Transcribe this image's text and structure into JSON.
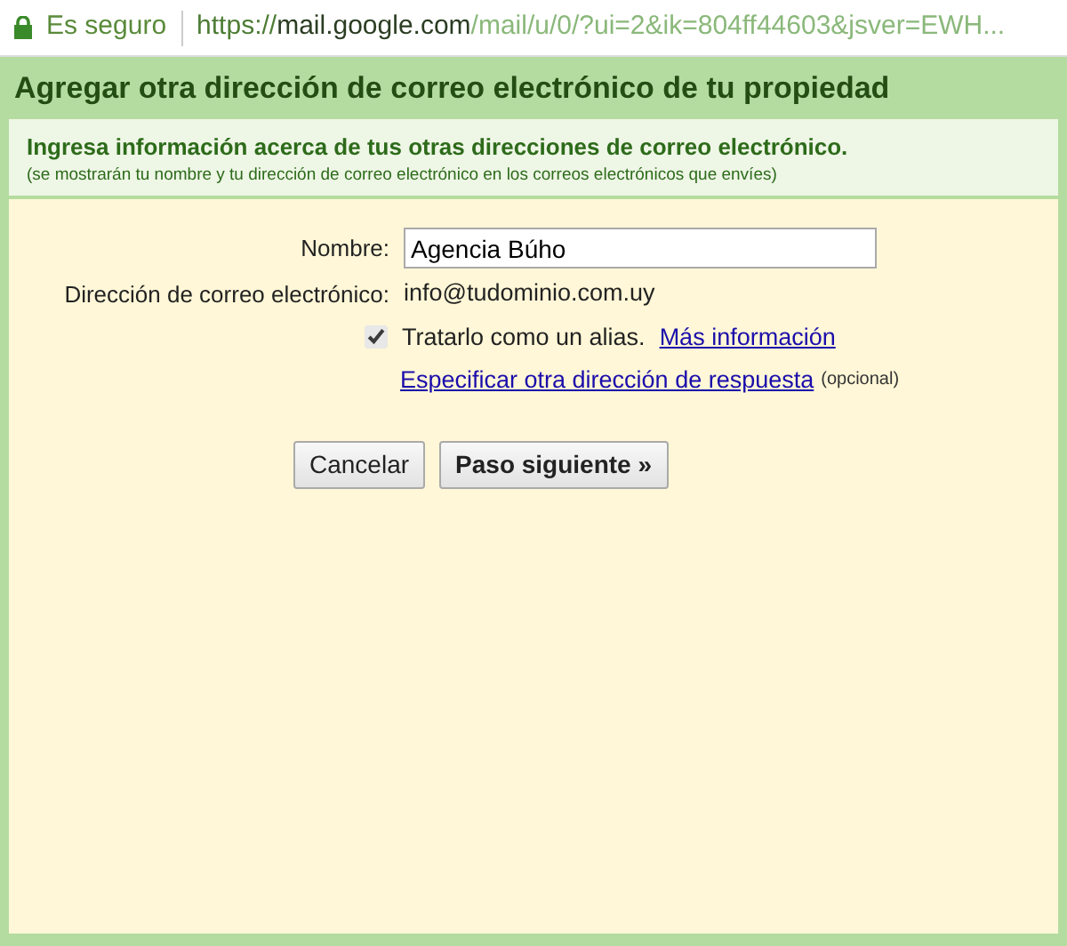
{
  "address_bar": {
    "security_label": "Es seguro",
    "url_scheme": "https://",
    "url_host": "mail.google.com",
    "url_path": "/mail/u/0/?ui=2&ik=804ff44603&jsver=EWH..."
  },
  "dialog": {
    "title": "Agregar otra dirección de correo electrónico de tu propiedad",
    "intro": {
      "heading": "Ingresa información acerca de tus otras direcciones de correo electrónico.",
      "note": "(se mostrarán tu nombre y tu dirección de correo electrónico en los correos electrónicos que envíes)"
    },
    "name_field": {
      "label": "Nombre:",
      "value": "Agencia Búho"
    },
    "email": {
      "label": "Dirección de correo electrónico:",
      "value": "info@tudominio.com.uy"
    },
    "alias": {
      "label": "Tratarlo como un alias.",
      "checked": true,
      "link": "Más información"
    },
    "reply_to": {
      "link": "Especificar otra dirección de respuesta",
      "note": "(opcional)"
    },
    "buttons": [
      {
        "label": "Cancelar",
        "primary": false
      },
      {
        "label": "Paso siguiente »",
        "primary": true
      }
    ]
  }
}
